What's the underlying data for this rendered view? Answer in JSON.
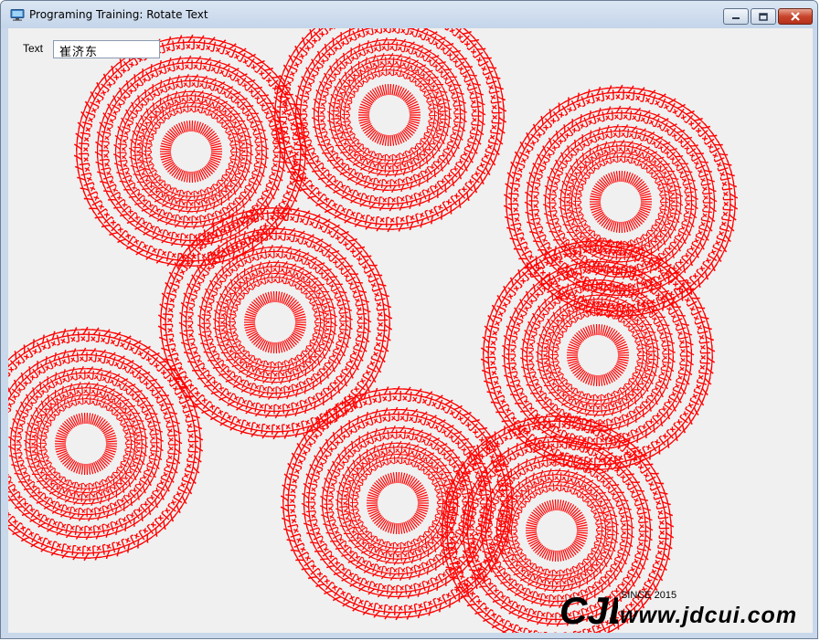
{
  "window": {
    "title": "Programing Training: Rotate Text"
  },
  "form": {
    "text_label": "Text",
    "text_value": "崔济东"
  },
  "canvas": {
    "glyph": "东",
    "color": "#ff0000"
  },
  "watermark": {
    "logo_text": "CJD",
    "since": "SINCE 2015",
    "domain": "www.jdcui.com"
  }
}
